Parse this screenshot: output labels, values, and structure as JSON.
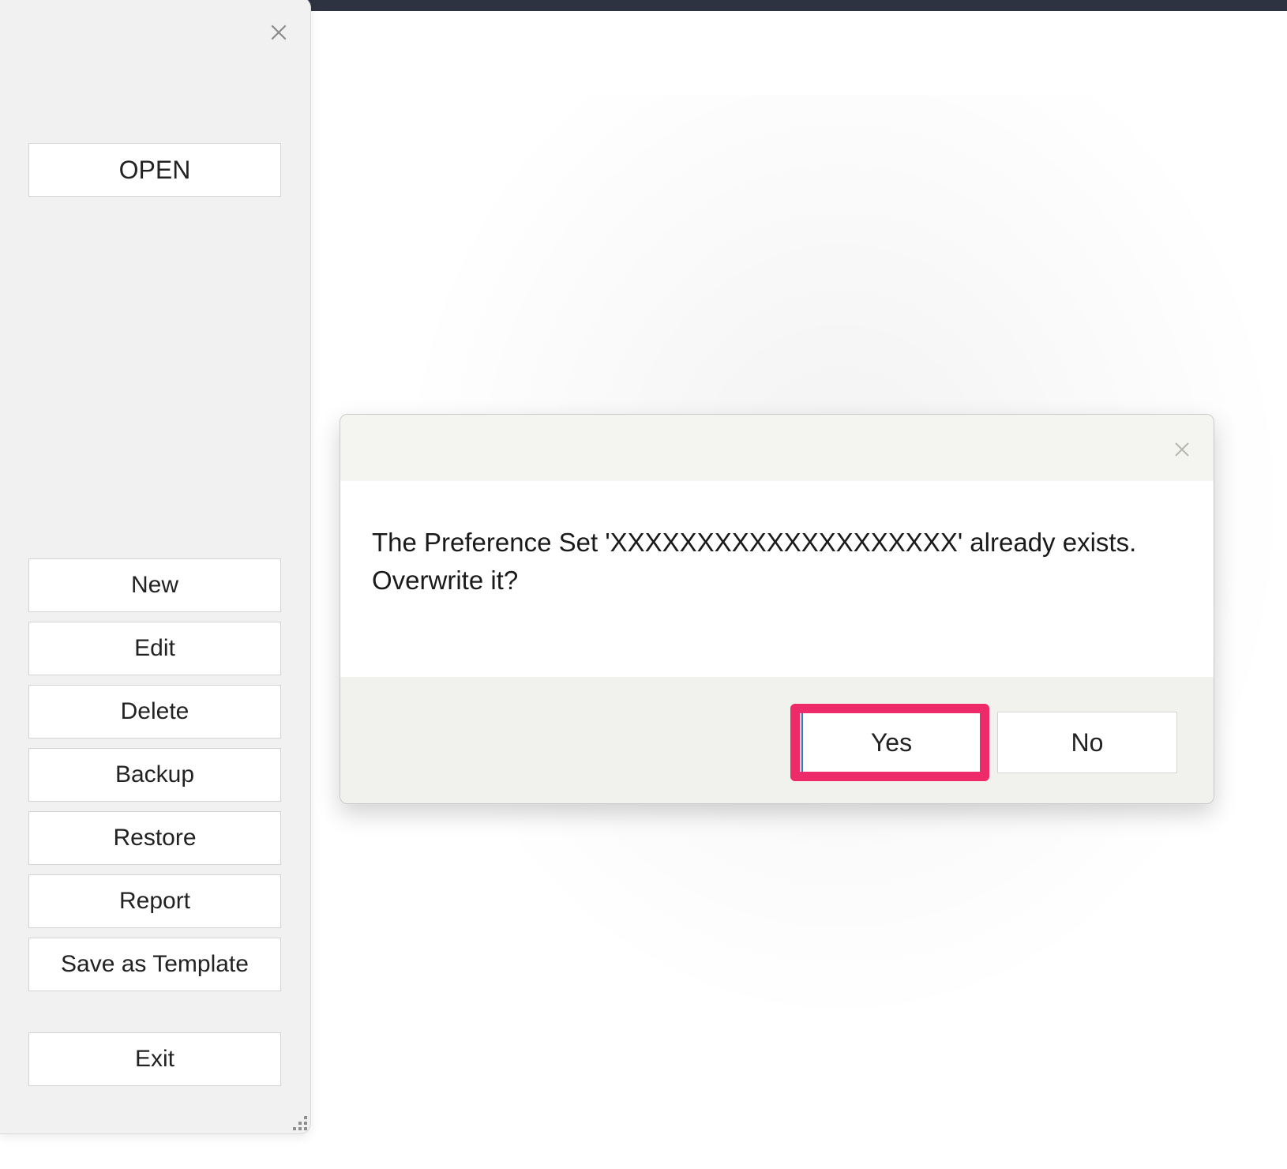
{
  "sidebar": {
    "open_label": "OPEN",
    "buttons": {
      "new": "New",
      "edit": "Edit",
      "delete": "Delete",
      "backup": "Backup",
      "restore": "Restore",
      "report": "Report",
      "save_as_template": "Save as Template",
      "exit": "Exit"
    }
  },
  "dialog": {
    "message_line1": "The Preference Set 'XXXXXXXXXXXXXXXXXXXX' already exists.",
    "message_line2": "Overwrite it?",
    "yes_label": "Yes",
    "no_label": "No"
  },
  "colors": {
    "highlight": "#ed2a6a",
    "focus_border": "#3a76c4",
    "topbar": "#2d3340"
  }
}
